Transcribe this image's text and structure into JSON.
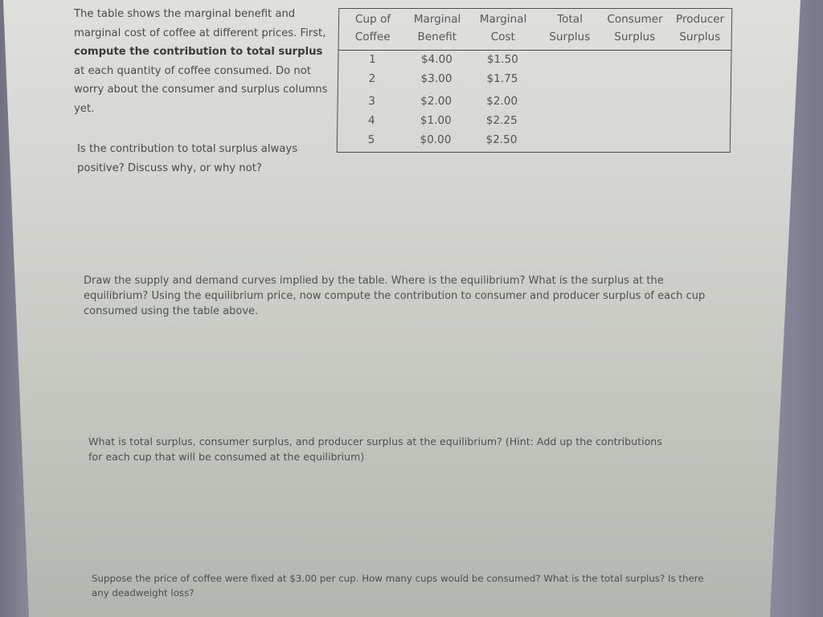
{
  "intro": {
    "line_before_bold": "The table shows the marginal benefit and marginal cost of coffee at different prices. First, ",
    "bold": "compute the contribution to total surplus",
    "line_after_bold": " at each quantity of coffee consumed. Do not worry about the consumer and surplus columns yet."
  },
  "question_positive": "Is the contribution to total surplus always positive? Discuss why, or why not?",
  "table": {
    "headers": [
      {
        "line1": "Cup of",
        "line2": "Coffee"
      },
      {
        "line1": "Marginal",
        "line2": "Benefit"
      },
      {
        "line1": "Marginal",
        "line2": "Cost"
      },
      {
        "line1": "Total",
        "line2": "Surplus"
      },
      {
        "line1": "Consumer",
        "line2": "Surplus"
      },
      {
        "line1": "Producer",
        "line2": "Surplus"
      }
    ],
    "rows": [
      {
        "cup": "1",
        "marginal_benefit": "$4.00",
        "marginal_cost": "$1.50",
        "total_surplus": "",
        "consumer_surplus": "",
        "producer_surplus": ""
      },
      {
        "cup": "2",
        "marginal_benefit": "$3.00",
        "marginal_cost": "$1.75",
        "total_surplus": "",
        "consumer_surplus": "",
        "producer_surplus": ""
      },
      {
        "cup": "3",
        "marginal_benefit": "$2.00",
        "marginal_cost": "$2.00",
        "total_surplus": "",
        "consumer_surplus": "",
        "producer_surplus": ""
      },
      {
        "cup": "4",
        "marginal_benefit": "$1.00",
        "marginal_cost": "$2.25",
        "total_surplus": "",
        "consumer_surplus": "",
        "producer_surplus": ""
      },
      {
        "cup": "5",
        "marginal_benefit": "$0.00",
        "marginal_cost": "$2.50",
        "total_surplus": "",
        "consumer_surplus": "",
        "producer_surplus": ""
      }
    ]
  },
  "question_draw": "Draw the supply and demand curves implied by the table. Where is the equilibrium? What is the surplus at the equilibrium? Using the equilibrium price, now compute the contribution to consumer and producer surplus of each cup consumed using the table above.",
  "question_totals": "What is total surplus, consumer surplus, and producer surplus at the equilibrium? (Hint: Add up the contributions for each cup that will be consumed at the equilibrium)",
  "question_price_fixed": "Suppose the price of coffee were fixed at $3.00 per cup. How many cups would be consumed? What is the total surplus? Is there any deadweight loss?"
}
